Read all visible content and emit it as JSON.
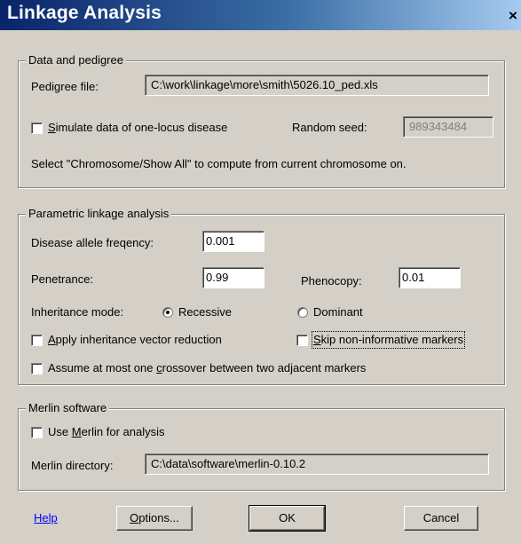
{
  "window": {
    "title": "Linkage Analysis",
    "close_label": "×"
  },
  "data_pedigree": {
    "legend": "Data and pedigree",
    "pedigree_label": "Pedigree file:",
    "pedigree_value": "C:\\work\\linkage\\more\\smith\\5026.10_ped.xls",
    "simulate_prefix": "S",
    "simulate_rest": "imulate data of one-locus disease",
    "simulate_checked": false,
    "seed_label": "Random seed:",
    "seed_value": "989343484",
    "note": "Select \"Chromosome/Show All\" to compute from current chromosome on."
  },
  "parametric": {
    "legend": "Parametric linkage analysis",
    "allele_freq_label": "Disease allele freqency:",
    "allele_freq_value": "0.001",
    "penetrance_label": "Penetrance:",
    "penetrance_value": "0.99",
    "phenocopy_label": "Phenocopy:",
    "phenocopy_value": "0.01",
    "inheritance_label": "Inheritance mode:",
    "recessive_label": "Recessive",
    "dominant_label": "Dominant",
    "selected_mode": "Recessive",
    "apply_prefix": "A",
    "apply_rest": "pply inheritance vector reduction",
    "apply_checked": false,
    "skip_prefix": "S",
    "skip_mid": "kip",
    "skip_rest": " non-informative markers",
    "skip_checked": false,
    "assume_before": "Assume at most one ",
    "assume_accel": "c",
    "assume_after": "rossover between two adjacent markers",
    "assume_checked": false
  },
  "merlin": {
    "legend": "Merlin software",
    "use_before": "Use ",
    "use_accel": "M",
    "use_after": "erlin for analysis",
    "use_checked": false,
    "dir_label": "Merlin directory:",
    "dir_value": "C:\\data\\software\\merlin-0.10.2"
  },
  "buttons": {
    "help": "Help",
    "options_accel": "O",
    "options_rest": "ptions...",
    "ok": "OK",
    "cancel": "Cancel"
  }
}
